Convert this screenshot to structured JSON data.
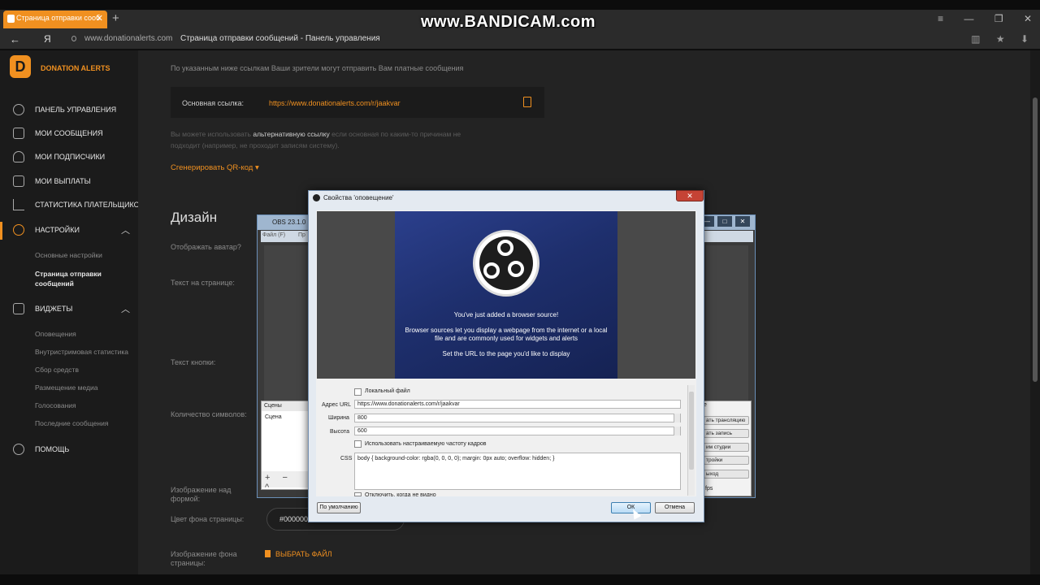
{
  "browser": {
    "tab_title": "Страница отправки сооб",
    "tab_close": "✕",
    "new_tab": "+",
    "watermark": "www.BANDICAM.com",
    "yandex_label": "Я",
    "url_domain": "www.donationalerts.com",
    "page_title": "Страница отправки сообщений - Панель управления",
    "window_controls": [
      "≡",
      "—",
      "❐",
      "✕"
    ],
    "right_icons": [
      "▥",
      "★",
      "⬇"
    ]
  },
  "sidebar": {
    "brand": "DONATION ALERTS",
    "logo_letter": "D",
    "nav": [
      {
        "label": "Панель управления",
        "icon": "dashboard-icon"
      },
      {
        "label": "Мои сообщения",
        "icon": "messages-icon"
      },
      {
        "label": "Мои подписчики",
        "icon": "subscribers-icon"
      },
      {
        "label": "Мои выплаты",
        "icon": "wallet-icon"
      },
      {
        "label": "Статистика плательщиков",
        "icon": "stats-icon"
      },
      {
        "label": "Настройки",
        "icon": "gear-icon"
      }
    ],
    "settings_sub": [
      "Основные настройки",
      "Страница отправки сообщений"
    ],
    "widgets_label": "Виджеты",
    "widgets_sub": [
      "Оповещения",
      "Внутристримовая статистика",
      "Сбор средств",
      "Размещение медиа",
      "Голосования",
      "Последние сообщения"
    ],
    "help_label": "Помощь"
  },
  "main": {
    "intro": "По указанным ниже ссылкам Ваши зрители могут отправить Вам платные сообщения",
    "main_link_label": "Основная ссылка:",
    "main_link_url": "https://www.donationalerts.com/r/jaakvar",
    "alt_note_1": "Вы можете использовать ",
    "alt_note_link": "альтернативную ссылку",
    "alt_note_2": " если основная по каким-то причинам не подходит (например, не проходит записям систему).",
    "qr_label": "Сгенерировать QR-код ▾",
    "design_heading": "Дизайн",
    "labels": {
      "avatar": "Отображать аватар?",
      "page_text": "Текст на странице:",
      "button_text": "Текст кнопки:",
      "char_count": "Количество символов:",
      "image_above": "Изображение над формой:",
      "page_bg_color": "Цвет фона страницы:",
      "page_bg_image": "Изображение фона страницы:"
    },
    "bg_color_value": "#000000",
    "choose_file": "ВЫБРАТЬ ФАЙЛ"
  },
  "obs_window": {
    "title": "OBS 23.1.0 (",
    "menu_items": [
      "Файл (F)",
      "Пр"
    ],
    "scenes_header": "Сцены",
    "scene_item": "Сцена",
    "scene_toolbar": "+ − ^",
    "controls_header": "е",
    "buttons": [
      "ать трансляцию",
      "ать запись",
      "им студии",
      "тройки",
      "ыход"
    ],
    "fps": "fps"
  },
  "dialog": {
    "title": "Свойства 'оповещение'",
    "close": "✕",
    "banner": {
      "headline": "You've just added a browser source!",
      "desc": "Browser sources let you display a webpage from the internet or a local file and are commonly used for widgets and alerts",
      "hint": "Set the URL to the page you'd like to display"
    },
    "local_file_label": "Локальный файл",
    "url_label": "Адрес URL",
    "url_value": "https://www.donationalerts.com/r/jaakvar",
    "width_label": "Ширина",
    "width_value": "800",
    "height_label": "Высота",
    "height_value": "600",
    "custom_fps_label": "Использовать настраиваемую частоту кадров",
    "css_label": "CSS",
    "css_value": "body { background-color: rgba(0, 0, 0, 0); margin: 0px auto; overflow: hidden; }",
    "cut_off_label": "Отключить, когда не видно",
    "default_button": "По умолчанию",
    "ok_button": "ОК",
    "cancel_button": "Отмена"
  }
}
